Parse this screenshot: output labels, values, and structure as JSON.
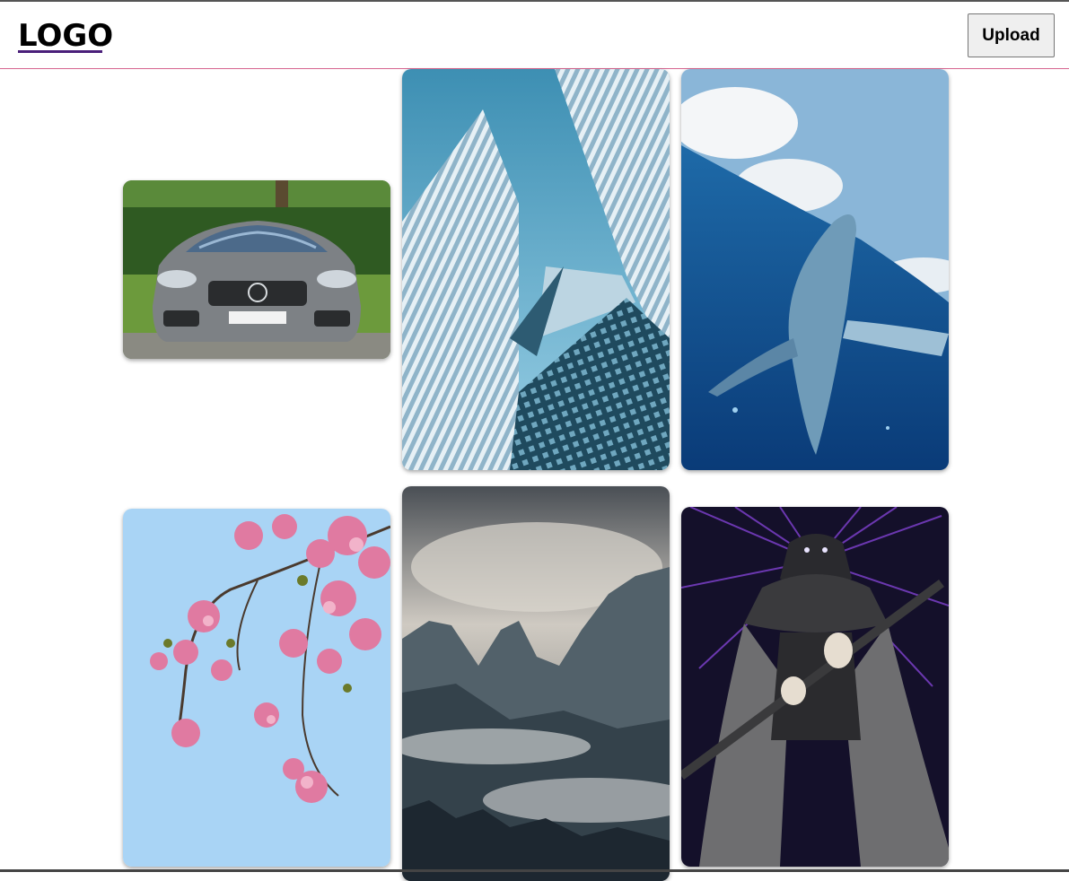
{
  "header": {
    "logo": "LOGO",
    "upload_label": "Upload"
  },
  "gallery": {
    "images": [
      {
        "subject": "silver-sports-car"
      },
      {
        "subject": "glass-skyscrapers"
      },
      {
        "subject": "breaching-whale"
      },
      {
        "subject": "cherry-blossoms"
      },
      {
        "subject": "cloudy-mountains"
      },
      {
        "subject": "dark-swordsman-illustration"
      }
    ]
  },
  "colors": {
    "header_border": "#d6648f",
    "logo_underline": "#4a1f7a",
    "button_bg": "#efefef"
  }
}
